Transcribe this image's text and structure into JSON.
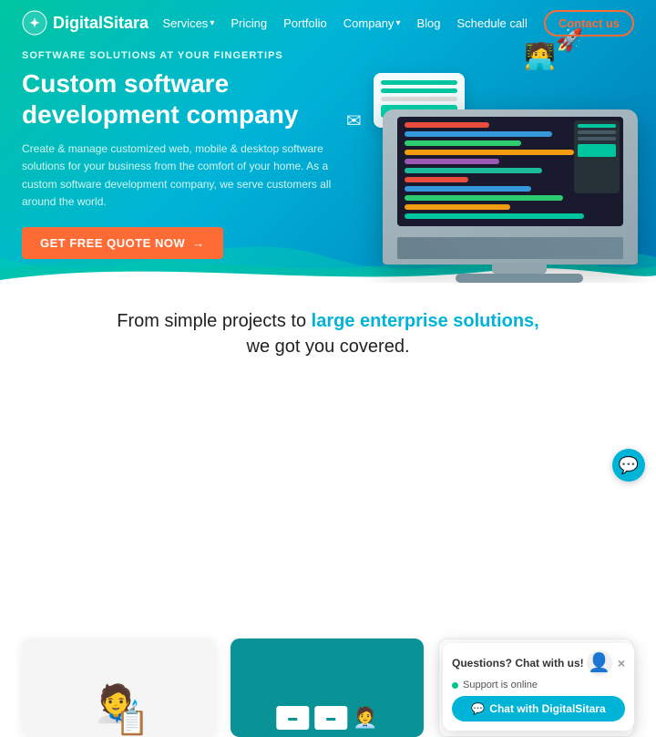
{
  "brand": {
    "name": "DigitalSitara",
    "logo_symbol": "✦"
  },
  "nav": {
    "links": [
      {
        "label": "Services",
        "has_dropdown": true
      },
      {
        "label": "Pricing",
        "has_dropdown": false
      },
      {
        "label": "Portfolio",
        "has_dropdown": false
      },
      {
        "label": "Company",
        "has_dropdown": true
      },
      {
        "label": "Blog",
        "has_dropdown": false
      }
    ],
    "schedule_label": "Schedule call",
    "contact_label": "Contact us"
  },
  "hero": {
    "sub_heading": "Software Solutions At Your Fingertips",
    "title_line1": "Custom software",
    "title_line2": "development company",
    "description": "Create & manage customized web, mobile & desktop software solutions for your business from the comfort of your home. As a custom software development company, we serve customers all around the world.",
    "cta_label": "GET FREE QUOTE NOW",
    "cta_arrow": "→"
  },
  "tagline": {
    "part1": "From simple projects to ",
    "highlight": "large enterprise solutions,",
    "part2": "we got you covered."
  },
  "chat_widget": {
    "header": "Questions? Chat with us!",
    "status": "Support is online",
    "button_label": "Chat with DigitalSitara",
    "close_icon": "×",
    "chat_icon": "💬"
  },
  "colors": {
    "teal": "#00c6a0",
    "blue": "#00b4d8",
    "orange": "#ff6b35",
    "dark": "#1a1a2e",
    "card2_bg": "#0a9396"
  }
}
